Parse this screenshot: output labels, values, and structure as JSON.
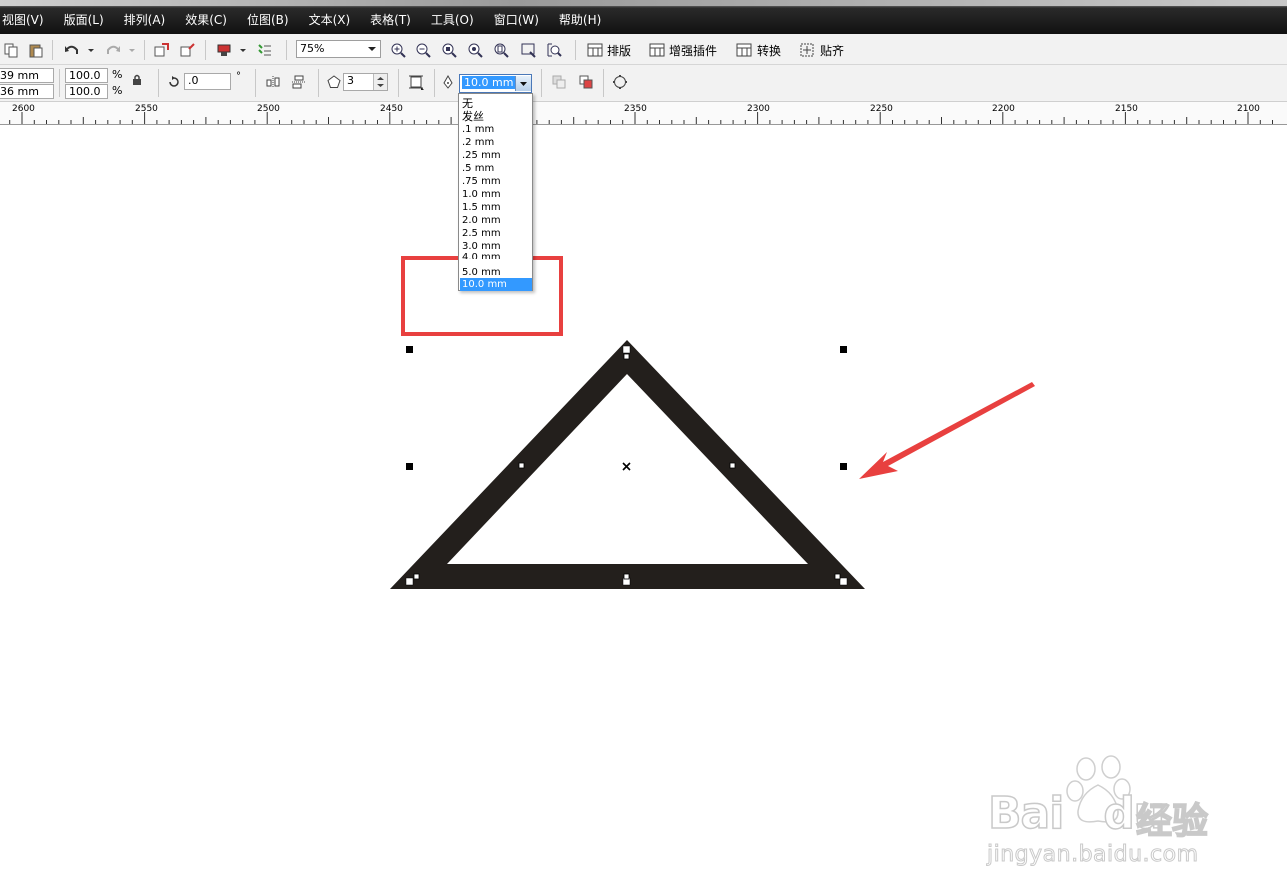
{
  "menubar": {
    "items": [
      "视图(V)",
      "版面(L)",
      "排列(A)",
      "效果(C)",
      "位图(B)",
      "文本(X)",
      "表格(T)",
      "工具(O)",
      "窗口(W)",
      "帮助(H)"
    ]
  },
  "toolbar": {
    "zoom": "75%",
    "layout_label": "排版",
    "plugins_label": "增强插件",
    "convert_label": "转换",
    "snap_label": "贴齐"
  },
  "property_bar": {
    "width": "39 mm",
    "height": "36 mm",
    "scale_x": "100.0",
    "scale_y": "100.0",
    "percent_symbol": "%",
    "rotation": ".0",
    "degree_symbol": "°",
    "sides": "3",
    "outline_width": "10.0 mm"
  },
  "ruler": {
    "labels": [
      "2600",
      "2550",
      "2500",
      "2450",
      "2400",
      "2350",
      "2300",
      "2250",
      "2200",
      "2150",
      "2100"
    ]
  },
  "outline_dropdown": {
    "options": [
      "无",
      "发丝",
      ".1 mm",
      ".2 mm",
      ".25 mm",
      ".5 mm",
      ".75 mm",
      "1.0 mm",
      "1.5 mm",
      "2.0 mm",
      "2.5 mm",
      "3.0 mm",
      "4.0 mm",
      "5.0 mm",
      "10.0 mm"
    ],
    "selected": "10.0 mm"
  },
  "watermark": {
    "brand": "Bai",
    "brand2": "du",
    "cn": "经验",
    "url": "jingyan.baidu.com"
  },
  "colors": {
    "annotation": "#e8403f",
    "shape": "#231f1c",
    "selection": "#3399ff"
  }
}
